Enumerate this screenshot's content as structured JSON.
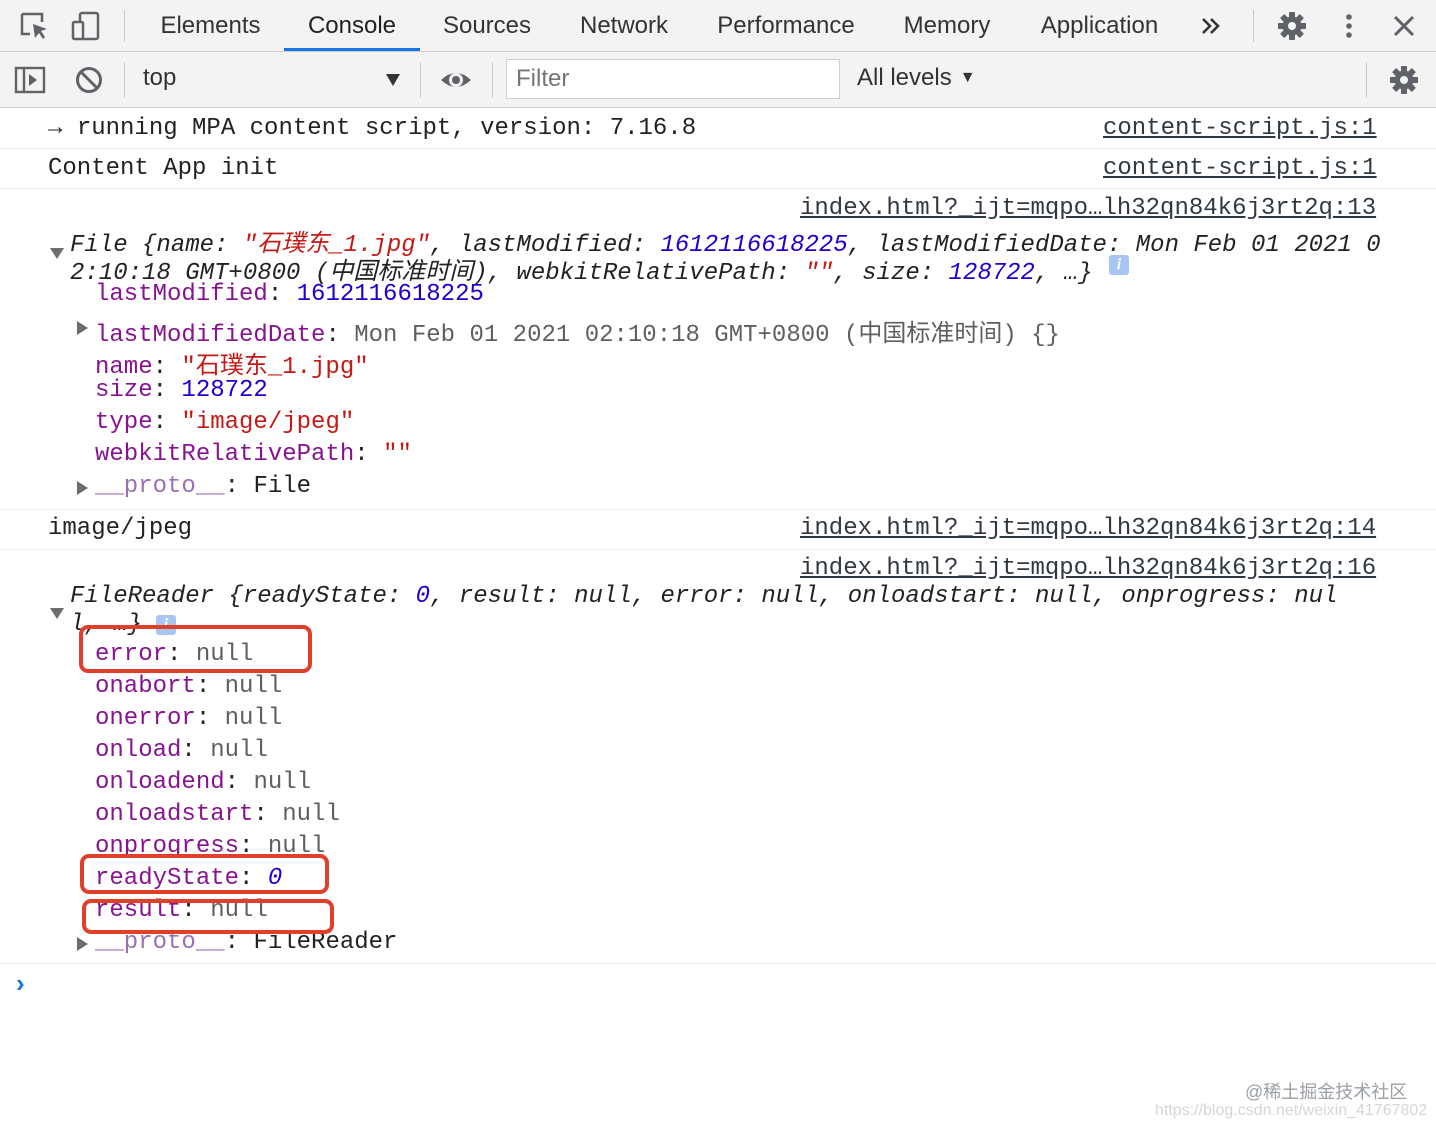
{
  "tabs": [
    "Elements",
    "Console",
    "Sources",
    "Network",
    "Performance",
    "Memory",
    "Application"
  ],
  "active_tab": "Console",
  "toolbar": {
    "context": "top",
    "filter_placeholder": "Filter",
    "levels": "All levels"
  },
  "messages": {
    "m1": {
      "arrow": "→",
      "text": "running MPA content script, version: 7.16.8",
      "source": "content-script.js:1"
    },
    "m2": {
      "text": "Content App init",
      "source": "content-script.js:1"
    },
    "m3": {
      "source": "index.html?_ijt=mqpo…lh32qn84k6j3rt2q:13",
      "summary": {
        "p1": "File {name: ",
        "p2": "\"石璞东_1.jpg\"",
        "p3": ", lastModified: ",
        "p4": "1612116618225",
        "p5": ", lastModifiedDate: ",
        "p6": "Mon Feb 01 2021 0",
        "line2a": "2:10:18 GMT+0800 (中国标准时间)",
        "line2b": ", webkitRelativePath: ",
        "line2c": "\"\"",
        "line2d": ", size: ",
        "line2e": "128722",
        "line2f": ", …}"
      },
      "props": {
        "lastModified_key": "lastModified",
        "lastModified_val": "1612116618225",
        "lastModifiedDate_key": "lastModifiedDate",
        "lastModifiedDate_val": "Mon Feb 01 2021 02:10:18 GMT+0800 (中国标准时间) {}",
        "name_key": "name",
        "name_val": "\"石璞东_1.jpg\"",
        "size_key": "size",
        "size_val": "128722",
        "type_key": "type",
        "type_val": "\"image/jpeg\"",
        "wrp_key": "webkitRelativePath",
        "wrp_val": "\"\"",
        "proto_key": "__proto__",
        "proto_val": "File"
      }
    },
    "m4": {
      "text": "image/jpeg",
      "source": "index.html?_ijt=mqpo…lh32qn84k6j3rt2q:14"
    },
    "m5": {
      "source": "index.html?_ijt=mqpo…lh32qn84k6j3rt2q:16",
      "summary": {
        "p1": "FileReader {readyState: ",
        "p2": "0",
        "p3": ", result: null, error: null, onloadstart: null, onprogress: nul",
        "line2": "l, …}"
      },
      "props": {
        "error_key": "error",
        "error_val": "null",
        "onabort_key": "onabort",
        "onabort_val": "null",
        "onerror_key": "onerror",
        "onerror_val": "null",
        "onload_key": "onload",
        "onload_val": "null",
        "onloadend_key": "onloadend",
        "onloadend_val": "null",
        "onloadstart_key": "onloadstart",
        "onloadstart_val": "null",
        "onprogress_key": "onprogress",
        "onprogress_val": "null",
        "readyState_key": "readyState",
        "readyState_val": "0",
        "result_key": "result",
        "result_val": "null",
        "proto_key": "__proto__",
        "proto_val": "FileReader"
      }
    }
  },
  "prompt": "›",
  "watermark": {
    "line1": "@稀土掘金技术社区",
    "line2": "https://blog.csdn.net/weixin_41767802"
  },
  "colors": {
    "accent": "#1a73e8",
    "string": "#c41a16",
    "number": "#1c00cf",
    "key": "#881391",
    "highlight": "#e0402a"
  }
}
